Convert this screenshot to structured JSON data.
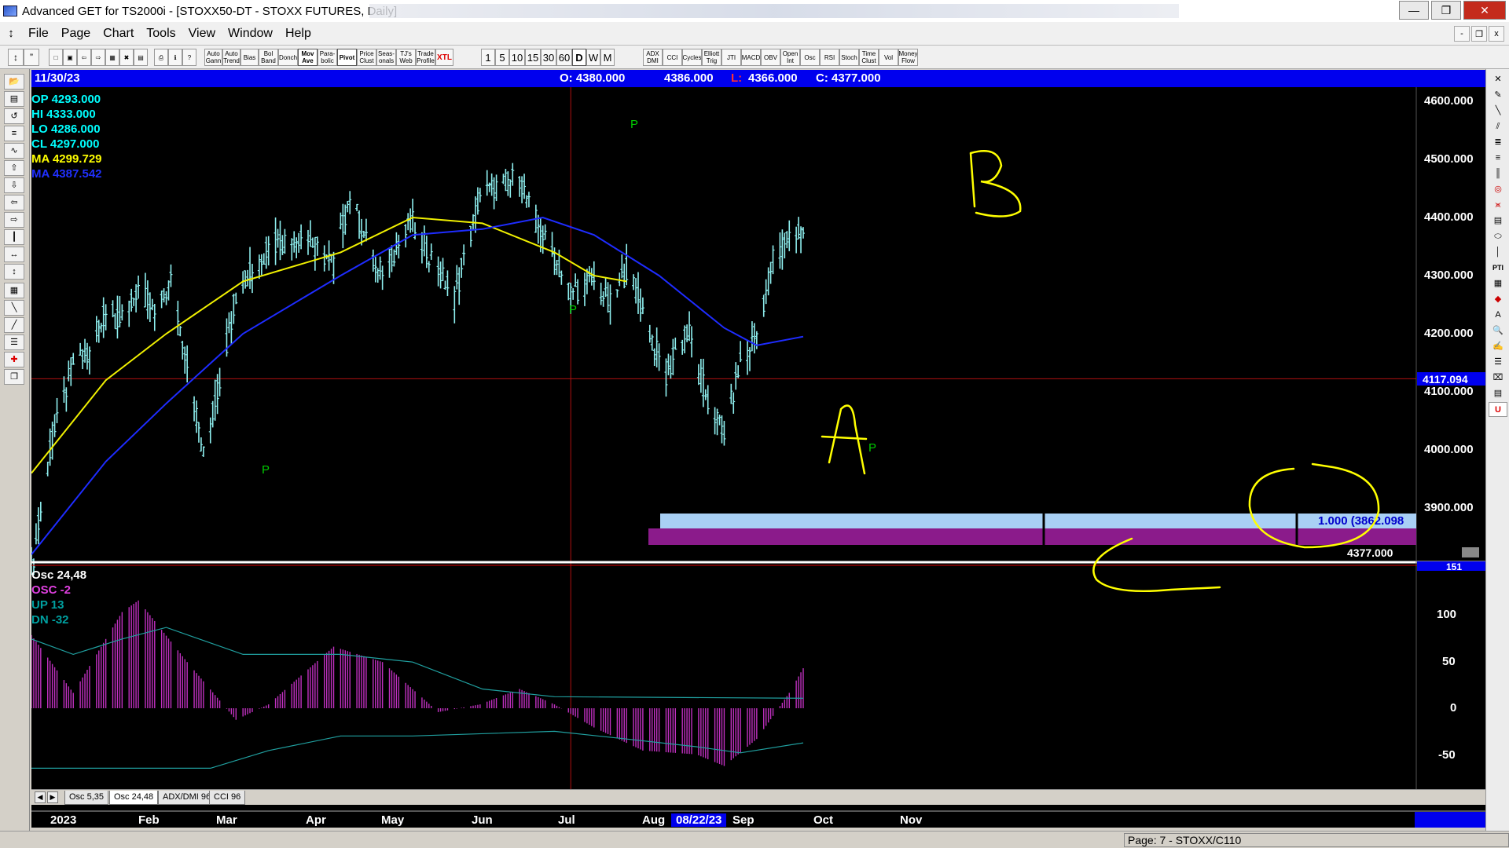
{
  "window": {
    "title": "Advanced GET for TS2000i - [STOXX50-DT - STOXX FUTURES, Daily]",
    "buttons": [
      "—",
      "❐",
      "✕"
    ]
  },
  "menu": {
    "items": [
      "File",
      "Page",
      "Chart",
      "Tools",
      "View",
      "Window",
      "Help"
    ],
    "mdi_buttons": [
      "-",
      "❐",
      "x"
    ]
  },
  "toolbar": {
    "study_buttons": [
      "Auto Gann",
      "Auto Trend",
      "Bias",
      "Bol Band",
      "Donch",
      "Mov Ave",
      "Para-bolic",
      "Pivot",
      "Price Clust",
      "Seas-onals",
      "TJ's Web",
      "Trade Profile",
      "XTL"
    ],
    "period_buttons": [
      "1",
      "5",
      "10",
      "15",
      "30",
      "60",
      "D",
      "W",
      "M"
    ],
    "selected_period": "D",
    "indicator_buttons": [
      "ADX DMI",
      "CCI",
      "Cycles",
      "Elliott Trig",
      "JTI",
      "MACD",
      "OBV",
      "Open Int",
      "Osc",
      "RSI",
      "Stoch",
      "Time Clust",
      "Vol",
      "Money Flow"
    ]
  },
  "header": {
    "date": "11/30/23",
    "open": "O: 4380.000",
    "high": "4386.000",
    "low_label": "L:",
    "low": "4366.000",
    "close": "C: 4377.000"
  },
  "legend": {
    "op": "OP  4293.000",
    "hi": "HI   4333.000",
    "lo": "LO  4286.000",
    "cl": "CL  4297.000",
    "ma1": "MA  4299.729",
    "ma2": "MA  4387.542"
  },
  "price_axis": {
    "ticks": [
      "4600.000",
      "4500.000",
      "4400.000",
      "4300.000",
      "4200.000",
      "4100.000",
      "4000.000",
      "3900.000"
    ],
    "current_price_marker": "4117.094",
    "last_close_marker": "4377.000"
  },
  "projection": {
    "label": "1.000 (3862.098"
  },
  "pivots": [
    "P",
    "P",
    "P",
    "P"
  ],
  "annotations": [
    "A",
    "B",
    "C"
  ],
  "oscillator": {
    "title": "Osc 24,48",
    "osc": "OSC -2",
    "up": "UP  13",
    "dn": "DN  -32",
    "ticks": [
      "151",
      "100",
      "50",
      "0",
      "-50"
    ]
  },
  "tabs": [
    "Osc 5,35",
    "Osc 24,48",
    "ADX/DMI 96",
    "CCI 96"
  ],
  "active_tab": "Osc 24,48",
  "date_axis": {
    "labels": [
      "2023",
      "Feb",
      "Mar",
      "Apr",
      "May",
      "Jun",
      "Jul",
      "Aug",
      "08/22/23",
      "Sep",
      "Oct",
      "Nov"
    ]
  },
  "status": {
    "page": "Page: 7 - STOXX/C110"
  },
  "chart_data": {
    "type": "bar",
    "title": "STOXX50-DT - STOXX FUTURES, Daily",
    "x_range": [
      "2023-01-02",
      "2023-11-30"
    ],
    "ylim": [
      3820,
      4630
    ],
    "grid": false,
    "price_path": [
      {
        "date": "2023-01-02",
        "close": 3790
      },
      {
        "date": "2023-01-10",
        "close": 4000
      },
      {
        "date": "2023-01-20",
        "close": 4150
      },
      {
        "date": "2023-01-27",
        "close": 4160
      },
      {
        "date": "2023-02-03",
        "close": 4240
      },
      {
        "date": "2023-02-10",
        "close": 4220
      },
      {
        "date": "2023-02-17",
        "close": 4280
      },
      {
        "date": "2023-02-24",
        "close": 4230
      },
      {
        "date": "2023-03-03",
        "close": 4290
      },
      {
        "date": "2023-03-10",
        "close": 4150
      },
      {
        "date": "2023-03-17",
        "close": 3990
      },
      {
        "date": "2023-03-24",
        "close": 4120
      },
      {
        "date": "2023-03-31",
        "close": 4270
      },
      {
        "date": "2023-04-14",
        "close": 4350
      },
      {
        "date": "2023-04-28",
        "close": 4370
      },
      {
        "date": "2023-05-12",
        "close": 4320
      },
      {
        "date": "2023-05-19",
        "close": 4440
      },
      {
        "date": "2023-05-31",
        "close": 4300
      },
      {
        "date": "2023-06-15",
        "close": 4390
      },
      {
        "date": "2023-06-26",
        "close": 4310
      },
      {
        "date": "2023-07-03",
        "close": 4260
      },
      {
        "date": "2023-07-14",
        "close": 4440
      },
      {
        "date": "2023-07-31",
        "close": 4470
      },
      {
        "date": "2023-08-04",
        "close": 4420
      },
      {
        "date": "2023-08-11",
        "close": 4360
      },
      {
        "date": "2023-08-22",
        "close": 4270
      },
      {
        "date": "2023-08-31",
        "close": 4290
      },
      {
        "date": "2023-09-08",
        "close": 4250
      },
      {
        "date": "2023-09-15",
        "close": 4310
      },
      {
        "date": "2023-09-22",
        "close": 4240
      },
      {
        "date": "2023-10-02",
        "close": 4120
      },
      {
        "date": "2023-10-06",
        "close": 4170
      },
      {
        "date": "2023-10-12",
        "close": 4200
      },
      {
        "date": "2023-10-20",
        "close": 4080
      },
      {
        "date": "2023-10-27",
        "close": 4030
      },
      {
        "date": "2023-11-03",
        "close": 4150
      },
      {
        "date": "2023-11-10",
        "close": 4200
      },
      {
        "date": "2023-11-17",
        "close": 4330
      },
      {
        "date": "2023-11-24",
        "close": 4370
      },
      {
        "date": "2023-11-30",
        "close": 4377
      }
    ],
    "ma_yellow": [
      {
        "date": "2023-01-02",
        "value": 3960
      },
      {
        "date": "2023-02-03",
        "value": 4120
      },
      {
        "date": "2023-03-01",
        "value": 4200
      },
      {
        "date": "2023-04-03",
        "value": 4290
      },
      {
        "date": "2023-05-15",
        "value": 4340
      },
      {
        "date": "2023-06-15",
        "value": 4400
      },
      {
        "date": "2023-07-15",
        "value": 4390
      },
      {
        "date": "2023-08-15",
        "value": 4340
      },
      {
        "date": "2023-09-01",
        "value": 4300
      },
      {
        "date": "2023-09-15",
        "value": 4290
      }
    ],
    "ma_blue": [
      {
        "date": "2023-01-02",
        "value": 3820
      },
      {
        "date": "2023-02-03",
        "value": 3980
      },
      {
        "date": "2023-03-01",
        "value": 4080
      },
      {
        "date": "2023-04-03",
        "value": 4200
      },
      {
        "date": "2023-05-15",
        "value": 4300
      },
      {
        "date": "2023-06-15",
        "value": 4370
      },
      {
        "date": "2023-07-15",
        "value": 4380
      },
      {
        "date": "2023-08-10",
        "value": 4400
      },
      {
        "date": "2023-09-01",
        "value": 4370
      },
      {
        "date": "2023-09-29",
        "value": 4300
      },
      {
        "date": "2023-10-27",
        "value": 4210
      },
      {
        "date": "2023-11-10",
        "value": 4180
      },
      {
        "date": "2023-11-30",
        "value": 4195
      }
    ],
    "horizontal_level": 4117.094,
    "oscillator": {
      "name": "Osc 24,48",
      "ylim": [
        -80,
        155
      ],
      "osc": [
        {
          "date": "2023-01-02",
          "value": 95
        },
        {
          "date": "2023-01-20",
          "value": 20
        },
        {
          "date": "2023-02-10",
          "value": 125
        },
        {
          "date": "2023-02-17",
          "value": 140
        },
        {
          "date": "2023-03-10",
          "value": 60
        },
        {
          "date": "2023-03-31",
          "value": -15
        },
        {
          "date": "2023-04-14",
          "value": 5
        },
        {
          "date": "2023-05-12",
          "value": 80
        },
        {
          "date": "2023-06-02",
          "value": 60
        },
        {
          "date": "2023-06-26",
          "value": -5
        },
        {
          "date": "2023-07-14",
          "value": 5
        },
        {
          "date": "2023-07-31",
          "value": 25
        },
        {
          "date": "2023-08-15",
          "value": 5
        },
        {
          "date": "2023-09-01",
          "value": -25
        },
        {
          "date": "2023-09-22",
          "value": -55
        },
        {
          "date": "2023-10-15",
          "value": -60
        },
        {
          "date": "2023-10-27",
          "value": -75
        },
        {
          "date": "2023-11-10",
          "value": -40
        },
        {
          "date": "2023-11-24",
          "value": 20
        },
        {
          "date": "2023-11-30",
          "value": 52
        }
      ],
      "up": [
        {
          "date": "2023-01-02",
          "value": 90
        },
        {
          "date": "2023-01-20",
          "value": 70
        },
        {
          "date": "2023-02-10",
          "value": 90
        },
        {
          "date": "2023-03-01",
          "value": 105
        },
        {
          "date": "2023-04-03",
          "value": 70
        },
        {
          "date": "2023-05-15",
          "value": 70
        },
        {
          "date": "2023-06-15",
          "value": 60
        },
        {
          "date": "2023-07-15",
          "value": 25
        },
        {
          "date": "2023-08-15",
          "value": 15
        },
        {
          "date": "2023-11-30",
          "value": 13
        }
      ],
      "dn": [
        {
          "date": "2023-01-02",
          "value": -78
        },
        {
          "date": "2023-03-20",
          "value": -78
        },
        {
          "date": "2023-04-14",
          "value": -55
        },
        {
          "date": "2023-05-15",
          "value": -36
        },
        {
          "date": "2023-06-15",
          "value": -36
        },
        {
          "date": "2023-08-15",
          "value": -30
        },
        {
          "date": "2023-09-15",
          "value": -40
        },
        {
          "date": "2023-10-15",
          "value": -50
        },
        {
          "date": "2023-11-03",
          "value": -58
        },
        {
          "date": "2023-11-30",
          "value": -45
        }
      ]
    }
  }
}
